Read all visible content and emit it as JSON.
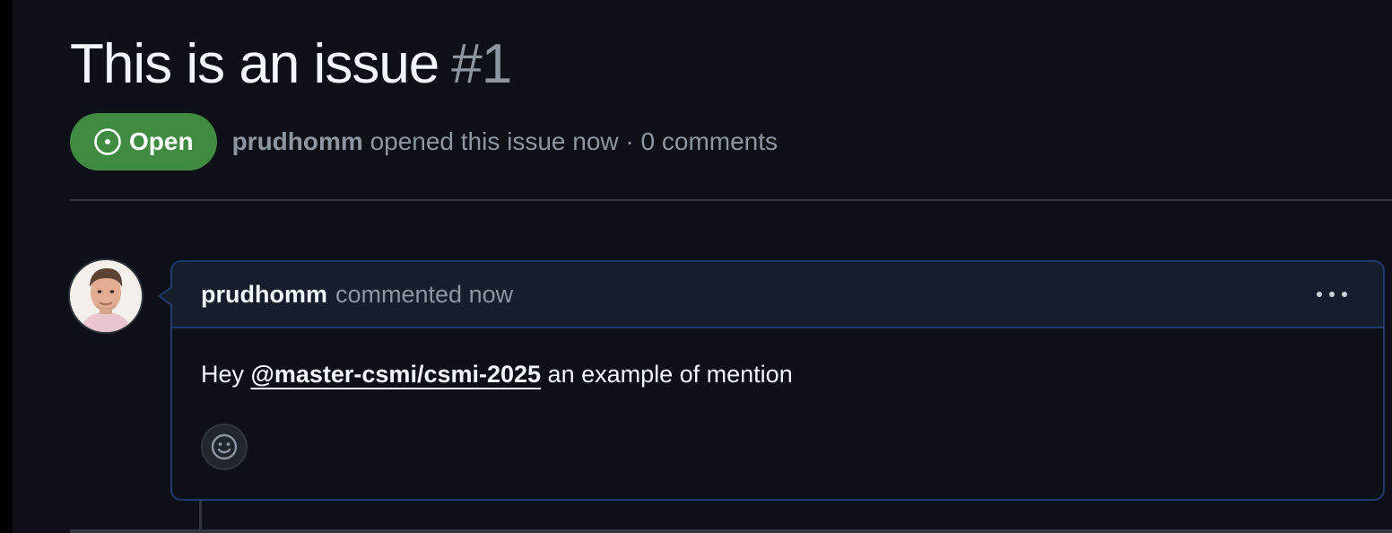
{
  "issue": {
    "title": "This is an issue",
    "number": "#1",
    "state": "Open",
    "author": "prudhomm",
    "opened_text": "opened this issue now · 0 comments"
  },
  "comment": {
    "author": "prudhomm",
    "action": "commented now",
    "body_prefix": "Hey ",
    "mention": "@master-csmi/csmi-2025",
    "body_suffix": " an example of mention"
  },
  "icons": {
    "state": "issue-opened-icon",
    "menu": "kebab-horizontal-icon",
    "reaction": "smiley-icon"
  },
  "colors": {
    "open_badge": "#3f8b41",
    "background": "#0d1117",
    "comment_border": "#1f3b6e",
    "comment_header": "#161d2c"
  }
}
